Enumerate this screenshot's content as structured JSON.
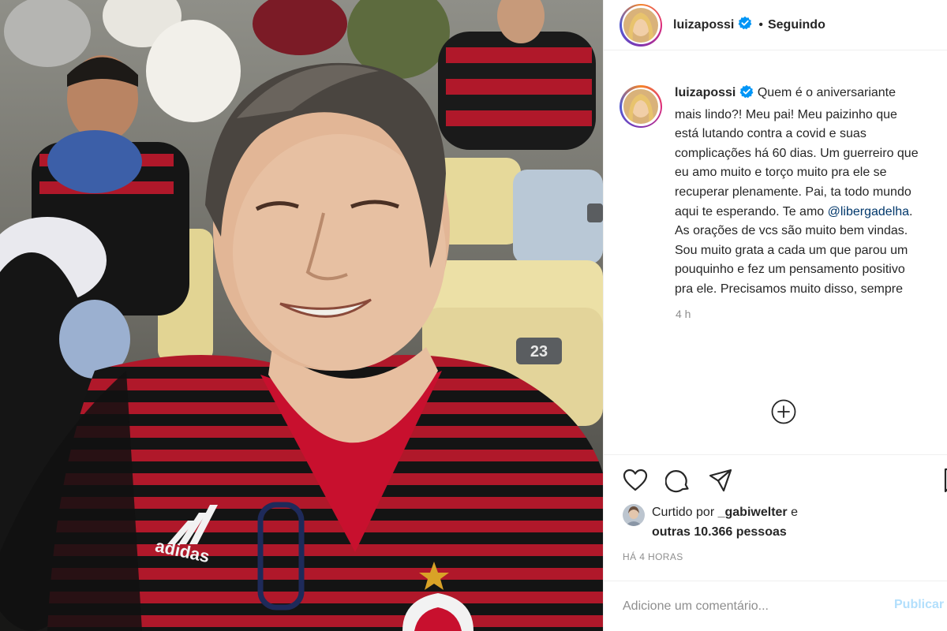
{
  "post": {
    "username": "luizapossi",
    "verified": true,
    "separator": "•",
    "follow_status": "Seguindo",
    "caption_before_mention": "Quem é o aniversariante mais lindo?! Meu pai! Meu paizinho que está lutando contra a covid e suas complicações há 60 dias. Um guerreiro que eu amo muito e torço muito pra ele se recuperar plenamente. Pai, ta todo mundo aqui te esperando. Te amo",
    "mention": "@libergadelha",
    "caption_after_mention": ". As orações de vcs são muito bem vindas. Sou muito grata a cada um que parou um pouquinho e fez um pensamento positivo pra ele. Precisamos muito disso, sempre",
    "caption_time": "4 h",
    "likes_prefix": "Curtido por",
    "likes_user": "_gabiwelter",
    "likes_joiner": "e",
    "likes_others": "outras 10.366 pessoas",
    "timestamp": "HÁ 4 HORAS",
    "comment_placeholder": "Adicione um comentário...",
    "publish_label": "Publicar"
  },
  "photo": {
    "shirt_brand_text": "adidas",
    "seat_numbers": [
      "23",
      "23"
    ]
  },
  "icons": {
    "verified": "verified-badge-icon",
    "more": "plus-circle-icon",
    "like": "heart-icon",
    "comment": "comment-bubble-icon",
    "share": "paper-plane-icon",
    "save": "bookmark-icon"
  },
  "colors": {
    "verified": "#0095f6",
    "mention": "#00376b",
    "publish_disabled": "#b2dffc",
    "secondary_text": "#8e8e8e",
    "flamengo_red": "#c8102e",
    "flamengo_black": "#111111"
  }
}
